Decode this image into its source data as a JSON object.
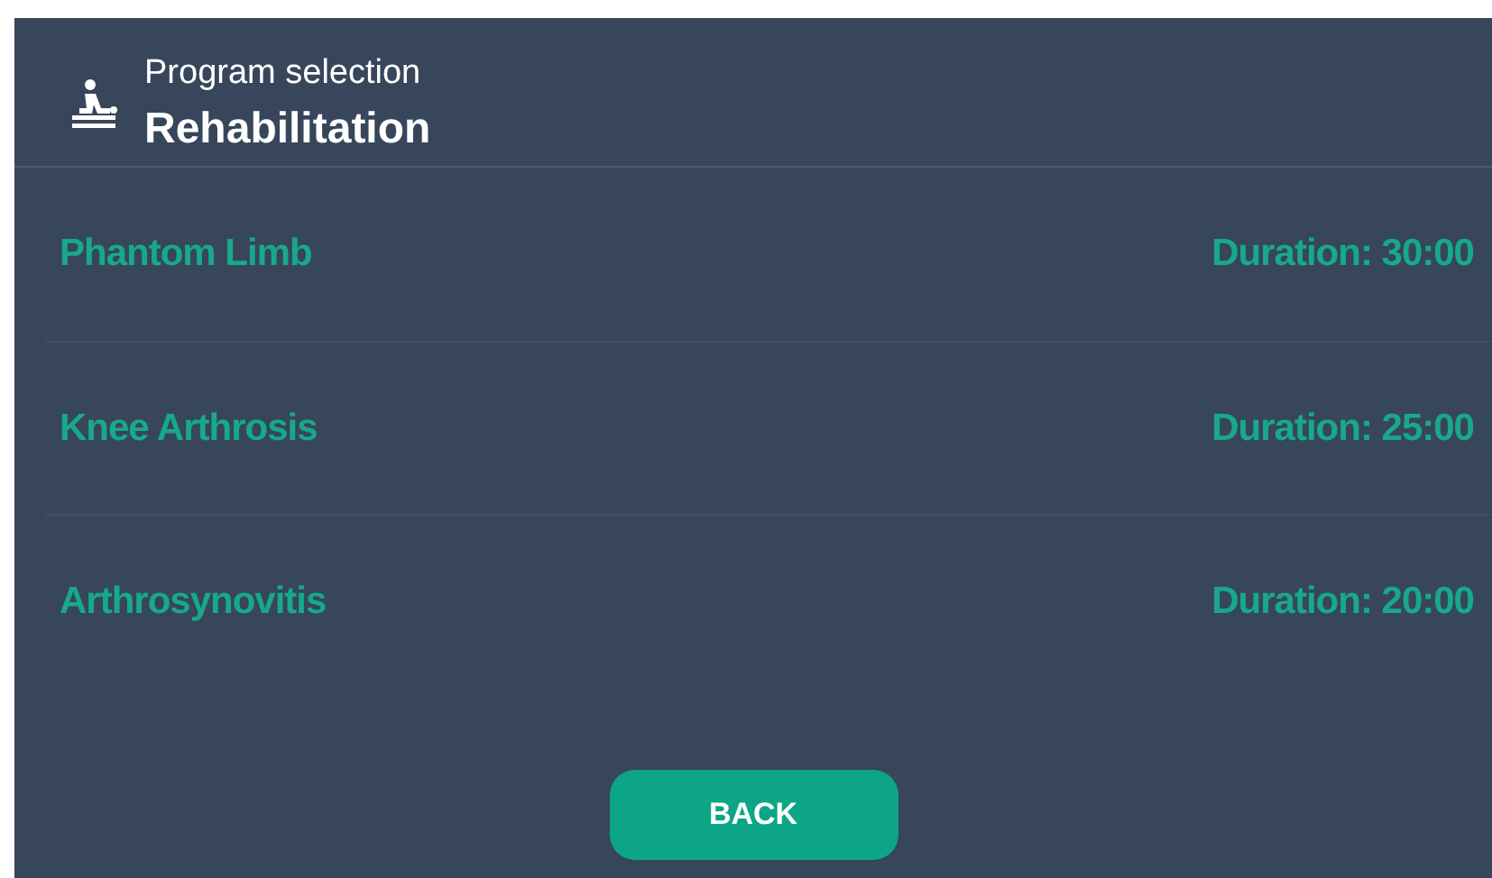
{
  "header": {
    "subtitle": "Program selection",
    "title": "Rehabilitation"
  },
  "programs": [
    {
      "name": "Phantom Limb",
      "duration": "Duration: 30:00"
    },
    {
      "name": "Knee Arthrosis",
      "duration": "Duration: 25:00"
    },
    {
      "name": "Arthrosynovitis",
      "duration": "Duration: 20:00"
    }
  ],
  "back_button": "BACK"
}
